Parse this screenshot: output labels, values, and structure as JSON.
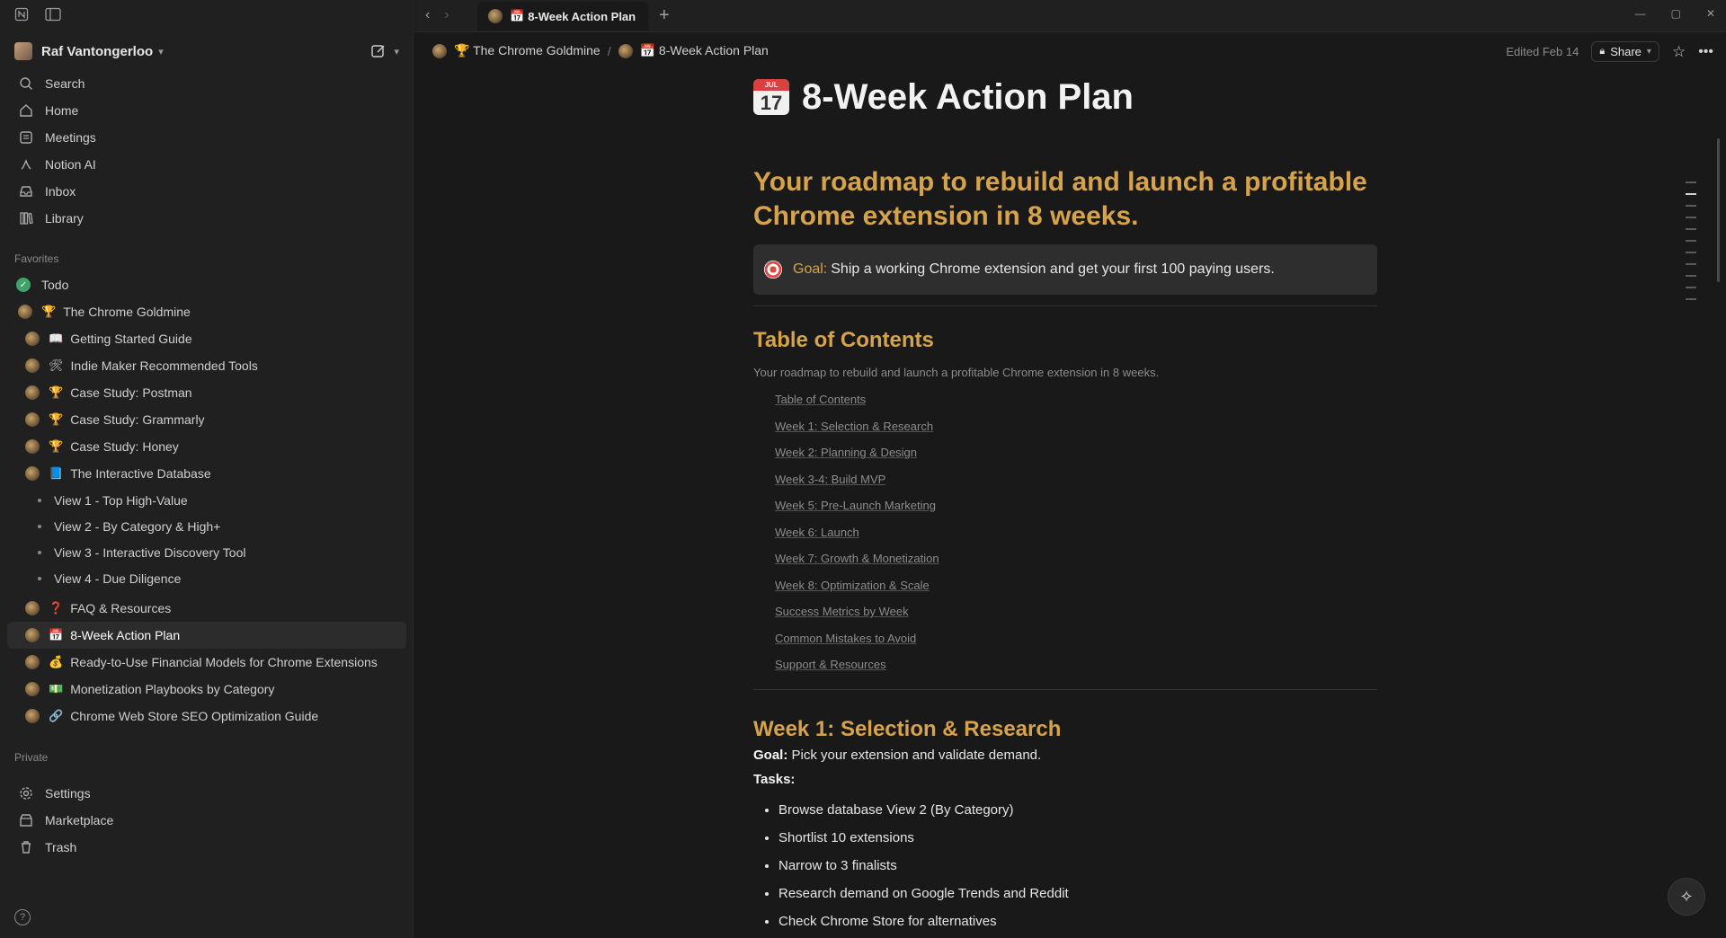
{
  "workspace": {
    "name": "Raf Vantongerloo"
  },
  "nav": [
    {
      "label": "Search",
      "icon": "search-icon"
    },
    {
      "label": "Home",
      "icon": "home-icon"
    },
    {
      "label": "Meetings",
      "icon": "meetings-icon"
    },
    {
      "label": "Notion AI",
      "icon": "notion-ai-icon"
    },
    {
      "label": "Inbox",
      "icon": "inbox-icon"
    },
    {
      "label": "Library",
      "icon": "library-icon"
    }
  ],
  "favorites_label": "Favorites",
  "favorites": [
    {
      "label": "Todo",
      "emoji": ""
    },
    {
      "label": "The Chrome Goldmine",
      "emoji": "🏆"
    },
    {
      "label": "Getting Started Guide",
      "emoji": "📖"
    },
    {
      "label": "Indie Maker Recommended Tools",
      "emoji": "🛠"
    },
    {
      "label": "Case Study: Postman",
      "emoji": "🏆"
    },
    {
      "label": "Case Study: Grammarly",
      "emoji": "🏆"
    },
    {
      "label": "Case Study: Honey",
      "emoji": "🏆"
    },
    {
      "label": "The Interactive Database",
      "emoji": "📘"
    },
    {
      "label": "View 1 - Top High-Value",
      "emoji": ""
    },
    {
      "label": "View 2 - By Category & High+",
      "emoji": ""
    },
    {
      "label": "View 3 - Interactive Discovery Tool",
      "emoji": ""
    },
    {
      "label": "View 4 - Due Diligence",
      "emoji": ""
    },
    {
      "label": "FAQ & Resources",
      "emoji": "❓"
    },
    {
      "label": "8-Week Action Plan",
      "emoji": "📅"
    },
    {
      "label": "Ready-to-Use Financial Models for Chrome Extensions",
      "emoji": "💰"
    },
    {
      "label": "Monetization Playbooks by Category",
      "emoji": "💵"
    },
    {
      "label": "Chrome Web Store SEO Optimization Guide",
      "emoji": "🔗"
    }
  ],
  "private_label": "Private",
  "private": [
    {
      "label": "Settings",
      "icon": "gear-icon"
    },
    {
      "label": "Marketplace",
      "icon": "marketplace-icon"
    },
    {
      "label": "Trash",
      "icon": "trash-icon"
    }
  ],
  "tab": {
    "title": "8-Week Action Plan",
    "emoji": "📅"
  },
  "breadcrumb": [
    {
      "label": "The Chrome Goldmine",
      "emoji": "🏆"
    },
    {
      "label": "8-Week Action Plan",
      "emoji": "📅"
    }
  ],
  "topbar": {
    "edited": "Edited Feb 14",
    "share": "Share"
  },
  "page": {
    "title": "8-Week Action Plan",
    "calendar_month": "JUL",
    "calendar_day": "17",
    "hero": "Your roadmap to rebuild and launch a profitable Chrome extension in 8 weeks.",
    "callout_label": "Goal:",
    "callout_text": "Ship a working Chrome extension and get your first 100 paying users.",
    "toc_heading": "Table of Contents",
    "toc_intro": "Your roadmap to rebuild and launch a profitable Chrome extension in 8 weeks.",
    "toc": [
      "Table of Contents",
      "Week 1: Selection & Research",
      "Week 2: Planning & Design",
      "Week 3-4: Build MVP",
      "Week 5: Pre-Launch Marketing",
      "Week 6: Launch",
      "Week 7: Growth & Monetization",
      "Week 8: Optimization & Scale",
      "Success Metrics by Week",
      "Common Mistakes to Avoid",
      "Support & Resources"
    ],
    "week1_heading": "Week 1: Selection & Research",
    "goal_label": "Goal:",
    "goal_text": "Pick your extension and validate demand.",
    "tasks_label": "Tasks:",
    "tasks": [
      "Browse database View 2 (By Category)",
      "Shortlist 10 extensions",
      "Narrow to 3 finalists",
      "Research demand on Google Trends and Reddit",
      "Check Chrome Store for alternatives"
    ]
  }
}
